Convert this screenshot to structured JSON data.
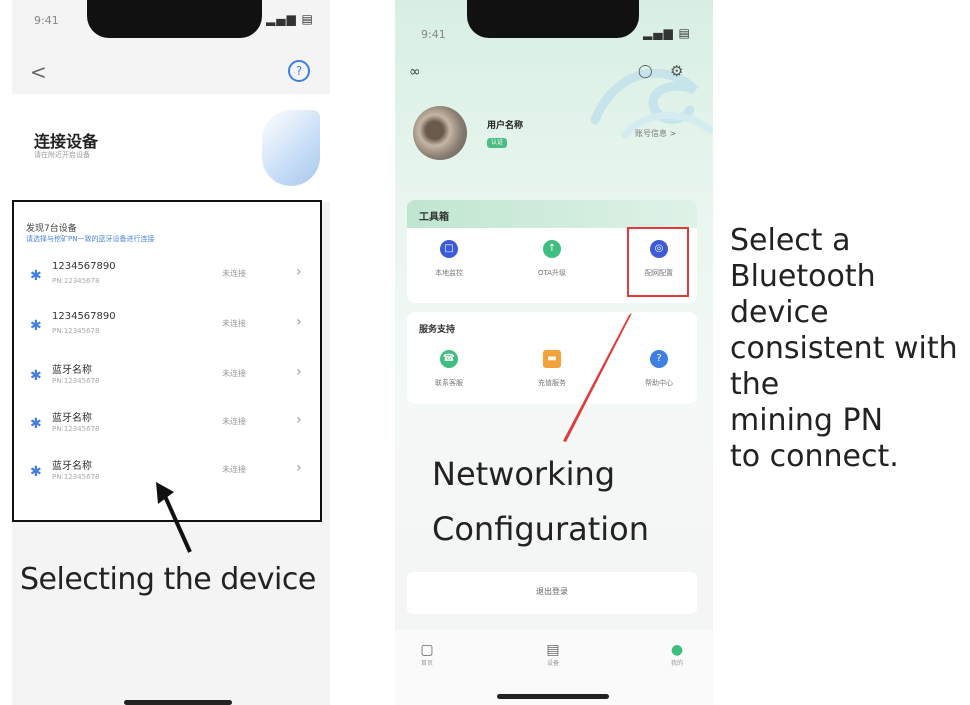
{
  "phone1": {
    "status_time": "9:41",
    "status_icons": "▂▄▆ ▤",
    "back_label": "<",
    "help_label": "?",
    "title": "连接设备",
    "subtitle": "请在附近开启设备",
    "found_label": "发现7台设备",
    "hint": "请选择与挖矿PN一致的蓝牙设备进行连接",
    "devices": [
      {
        "name": "1234567890",
        "pn": "PN:12345678",
        "status": "未连接"
      },
      {
        "name": "1234567890",
        "pn": "PN:12345678",
        "status": "未连接"
      },
      {
        "name": "蓝牙名称",
        "pn": "PN:12345678",
        "status": "未连接"
      },
      {
        "name": "蓝牙名称",
        "pn": "PN:12345678",
        "status": "未连接"
      },
      {
        "name": "蓝牙名称",
        "pn": "PN:12345678",
        "status": "未连接"
      }
    ],
    "caption": "Selecting the device"
  },
  "phone2": {
    "status_time": "9:41",
    "status_icons": "▂▄▆ ▤",
    "username": "用户名称",
    "badge": "认证",
    "account_link": "账号信息 >",
    "tools_title": "工具箱",
    "tools": [
      {
        "label": "本地监控",
        "color": "#3c5bd6"
      },
      {
        "label": "OTA升级",
        "color": "#3fbf7f"
      },
      {
        "label": "配网配置",
        "color": "#3c5bd6"
      }
    ],
    "services_title": "服务支持",
    "services": [
      {
        "label": "联系客服",
        "color": "#3fbf7f"
      },
      {
        "label": "充值服务",
        "color": "#f2a33a"
      },
      {
        "label": "帮助中心",
        "color": "#3f7fe0"
      }
    ],
    "feedback_label": "退出登录",
    "tabs": [
      {
        "label": "首页"
      },
      {
        "label": "设备"
      },
      {
        "label": "我的"
      }
    ],
    "caption_line1": "Networking",
    "caption_line2": "Configuration"
  },
  "right_caption": [
    "Select a",
    "Bluetooth",
    "device",
    "consistent with",
    "the",
    "mining PN",
    "to connect."
  ],
  "colors": {
    "accent_blue": "#3f7fe0",
    "accent_green": "#4bbd84",
    "highlight_red": "#e23a3a"
  }
}
